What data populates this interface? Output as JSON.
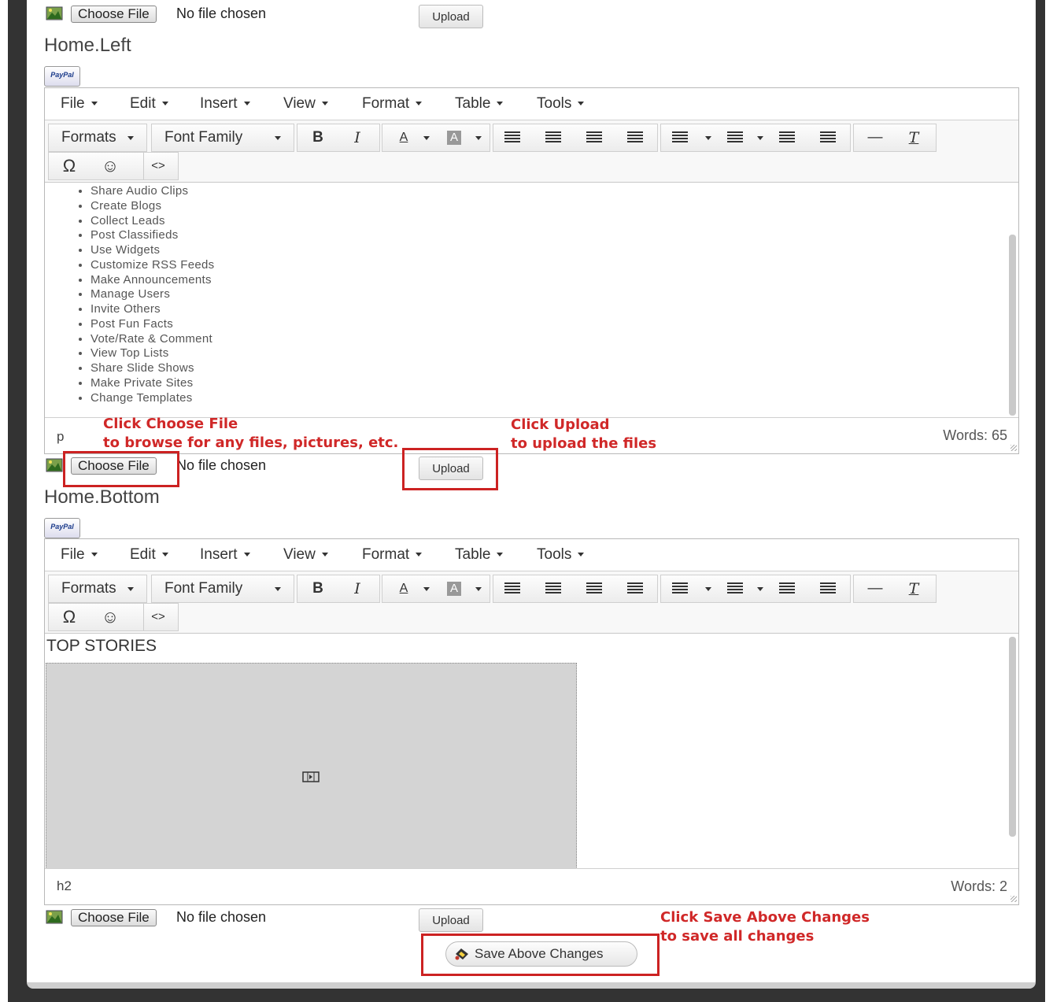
{
  "file_inputs": [
    {
      "choose_label": "Choose File",
      "status": "No file chosen",
      "upload_label": "Upload"
    },
    {
      "choose_label": "Choose File",
      "status": "No file chosen",
      "upload_label": "Upload"
    },
    {
      "choose_label": "Choose File",
      "status": "No file chosen",
      "upload_label": "Upload"
    }
  ],
  "editors": [
    {
      "title": "Home.Left",
      "paypal_label": "PayPal",
      "menu": [
        "File",
        "Edit",
        "Insert",
        "View",
        "Format",
        "Table",
        "Tools"
      ],
      "toolbar": {
        "formats": "Formats",
        "font_family": "Font Family",
        "bold": "B",
        "italic": "I",
        "forecolor": "A",
        "backcolor": "A",
        "omega": "Ω",
        "emoticon": "☺",
        "code": "<>",
        "clear": "T"
      },
      "list_items": [
        "Share Audio Clips",
        "Create Blogs",
        "Collect Leads",
        "Post Classifieds",
        "Use Widgets",
        "Customize RSS Feeds",
        "Make Announcements",
        "Manage Users",
        "Invite Others",
        "Post Fun Facts",
        "Vote/Rate & Comment",
        "View Top Lists",
        "Share Slide Shows",
        "Make Private Sites",
        "Change Templates"
      ],
      "path": "p",
      "word_count": "Words: 65"
    },
    {
      "title": "Home.Bottom",
      "paypal_label": "PayPal",
      "menu": [
        "File",
        "Edit",
        "Insert",
        "View",
        "Format",
        "Table",
        "Tools"
      ],
      "toolbar": {
        "formats": "Formats",
        "font_family": "Font Family",
        "bold": "B",
        "italic": "I",
        "forecolor": "A",
        "backcolor": "A",
        "omega": "Ω",
        "emoticon": "☺",
        "code": "<>",
        "clear": "T"
      },
      "heading": "TOP STORIES",
      "path": "h2",
      "word_count": "Words: 2"
    }
  ],
  "annotations": {
    "choose": {
      "line1": "Click Choose File",
      "line2": "to browse for any files, pictures, etc."
    },
    "upload": {
      "line1": "Click Upload",
      "line2": "to upload the files"
    },
    "save": {
      "line1": "Click Save Above Changes",
      "line2": "to save all changes"
    }
  },
  "save_button": {
    "label": "Save Above Changes",
    "icon": "save-icon"
  },
  "colors": {
    "annotation": "#d02828",
    "frame": "#333333"
  }
}
